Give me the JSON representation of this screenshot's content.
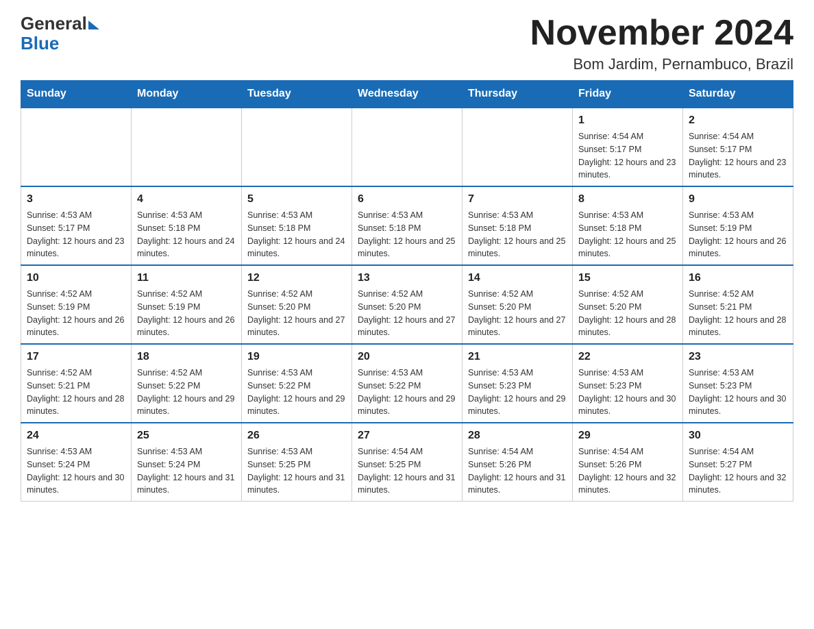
{
  "header": {
    "logo_general": "General",
    "logo_blue": "Blue",
    "title": "November 2024",
    "subtitle": "Bom Jardim, Pernambuco, Brazil"
  },
  "calendar": {
    "weekdays": [
      "Sunday",
      "Monday",
      "Tuesday",
      "Wednesday",
      "Thursday",
      "Friday",
      "Saturday"
    ],
    "weeks": [
      [
        {
          "day": "",
          "info": ""
        },
        {
          "day": "",
          "info": ""
        },
        {
          "day": "",
          "info": ""
        },
        {
          "day": "",
          "info": ""
        },
        {
          "day": "",
          "info": ""
        },
        {
          "day": "1",
          "info": "Sunrise: 4:54 AM\nSunset: 5:17 PM\nDaylight: 12 hours and 23 minutes."
        },
        {
          "day": "2",
          "info": "Sunrise: 4:54 AM\nSunset: 5:17 PM\nDaylight: 12 hours and 23 minutes."
        }
      ],
      [
        {
          "day": "3",
          "info": "Sunrise: 4:53 AM\nSunset: 5:17 PM\nDaylight: 12 hours and 23 minutes."
        },
        {
          "day": "4",
          "info": "Sunrise: 4:53 AM\nSunset: 5:18 PM\nDaylight: 12 hours and 24 minutes."
        },
        {
          "day": "5",
          "info": "Sunrise: 4:53 AM\nSunset: 5:18 PM\nDaylight: 12 hours and 24 minutes."
        },
        {
          "day": "6",
          "info": "Sunrise: 4:53 AM\nSunset: 5:18 PM\nDaylight: 12 hours and 25 minutes."
        },
        {
          "day": "7",
          "info": "Sunrise: 4:53 AM\nSunset: 5:18 PM\nDaylight: 12 hours and 25 minutes."
        },
        {
          "day": "8",
          "info": "Sunrise: 4:53 AM\nSunset: 5:18 PM\nDaylight: 12 hours and 25 minutes."
        },
        {
          "day": "9",
          "info": "Sunrise: 4:53 AM\nSunset: 5:19 PM\nDaylight: 12 hours and 26 minutes."
        }
      ],
      [
        {
          "day": "10",
          "info": "Sunrise: 4:52 AM\nSunset: 5:19 PM\nDaylight: 12 hours and 26 minutes."
        },
        {
          "day": "11",
          "info": "Sunrise: 4:52 AM\nSunset: 5:19 PM\nDaylight: 12 hours and 26 minutes."
        },
        {
          "day": "12",
          "info": "Sunrise: 4:52 AM\nSunset: 5:20 PM\nDaylight: 12 hours and 27 minutes."
        },
        {
          "day": "13",
          "info": "Sunrise: 4:52 AM\nSunset: 5:20 PM\nDaylight: 12 hours and 27 minutes."
        },
        {
          "day": "14",
          "info": "Sunrise: 4:52 AM\nSunset: 5:20 PM\nDaylight: 12 hours and 27 minutes."
        },
        {
          "day": "15",
          "info": "Sunrise: 4:52 AM\nSunset: 5:20 PM\nDaylight: 12 hours and 28 minutes."
        },
        {
          "day": "16",
          "info": "Sunrise: 4:52 AM\nSunset: 5:21 PM\nDaylight: 12 hours and 28 minutes."
        }
      ],
      [
        {
          "day": "17",
          "info": "Sunrise: 4:52 AM\nSunset: 5:21 PM\nDaylight: 12 hours and 28 minutes."
        },
        {
          "day": "18",
          "info": "Sunrise: 4:52 AM\nSunset: 5:22 PM\nDaylight: 12 hours and 29 minutes."
        },
        {
          "day": "19",
          "info": "Sunrise: 4:53 AM\nSunset: 5:22 PM\nDaylight: 12 hours and 29 minutes."
        },
        {
          "day": "20",
          "info": "Sunrise: 4:53 AM\nSunset: 5:22 PM\nDaylight: 12 hours and 29 minutes."
        },
        {
          "day": "21",
          "info": "Sunrise: 4:53 AM\nSunset: 5:23 PM\nDaylight: 12 hours and 29 minutes."
        },
        {
          "day": "22",
          "info": "Sunrise: 4:53 AM\nSunset: 5:23 PM\nDaylight: 12 hours and 30 minutes."
        },
        {
          "day": "23",
          "info": "Sunrise: 4:53 AM\nSunset: 5:23 PM\nDaylight: 12 hours and 30 minutes."
        }
      ],
      [
        {
          "day": "24",
          "info": "Sunrise: 4:53 AM\nSunset: 5:24 PM\nDaylight: 12 hours and 30 minutes."
        },
        {
          "day": "25",
          "info": "Sunrise: 4:53 AM\nSunset: 5:24 PM\nDaylight: 12 hours and 31 minutes."
        },
        {
          "day": "26",
          "info": "Sunrise: 4:53 AM\nSunset: 5:25 PM\nDaylight: 12 hours and 31 minutes."
        },
        {
          "day": "27",
          "info": "Sunrise: 4:54 AM\nSunset: 5:25 PM\nDaylight: 12 hours and 31 minutes."
        },
        {
          "day": "28",
          "info": "Sunrise: 4:54 AM\nSunset: 5:26 PM\nDaylight: 12 hours and 31 minutes."
        },
        {
          "day": "29",
          "info": "Sunrise: 4:54 AM\nSunset: 5:26 PM\nDaylight: 12 hours and 32 minutes."
        },
        {
          "day": "30",
          "info": "Sunrise: 4:54 AM\nSunset: 5:27 PM\nDaylight: 12 hours and 32 minutes."
        }
      ]
    ]
  }
}
